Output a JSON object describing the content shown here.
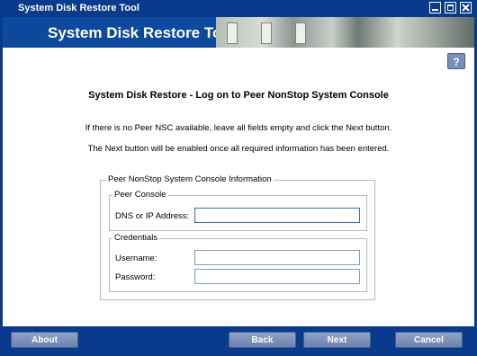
{
  "window": {
    "title": "System Disk Restore Tool"
  },
  "banner": {
    "title": "System Disk Restore Tool"
  },
  "help": {
    "label": "?"
  },
  "page": {
    "heading": "System Disk Restore - Log on to Peer NonStop System Console",
    "info_line1": "If there is no Peer NSC available, leave all fields empty and click the Next button.",
    "info_line2": "The Next button will be enabled once all required information has been entered."
  },
  "form": {
    "group_title": "Peer NonStop System Console Information",
    "console": {
      "title": "Peer Console",
      "dns_label": "DNS or IP Address:",
      "dns_value": ""
    },
    "credentials": {
      "title": "Credentials",
      "username_label": "Username:",
      "username_value": "",
      "password_label": "Password:",
      "password_value": ""
    }
  },
  "buttons": {
    "about": "About",
    "back": "Back",
    "next": "Next",
    "cancel": "Cancel"
  },
  "colors": {
    "chrome": "#0a3a8c",
    "button": "#7a8fb8"
  }
}
